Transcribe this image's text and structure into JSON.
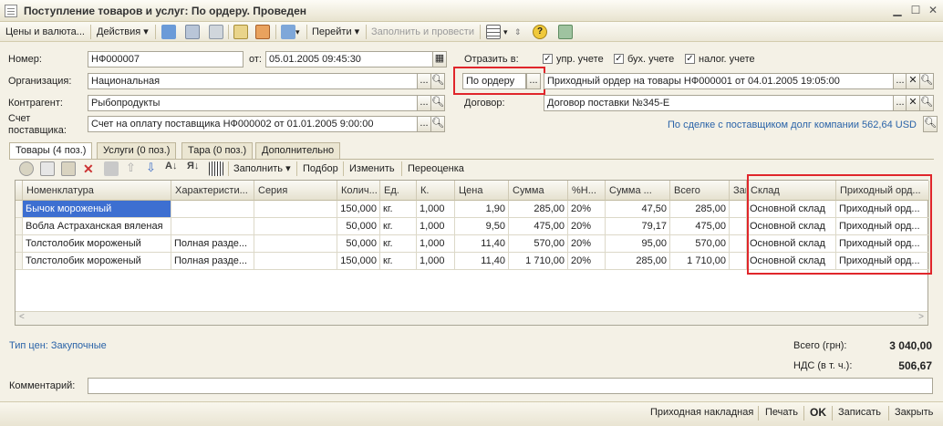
{
  "window": {
    "title": "Поступление товаров и услуг: По ордеру. Проведен"
  },
  "toolbar": {
    "prices": "Цены и валюта...",
    "actions": "Действия",
    "goto": "Перейти",
    "fill_post": "Заполнить и провести"
  },
  "form": {
    "number_label": "Номер:",
    "number": "НФ000007",
    "date_label": "от:",
    "date": "05.01.2005 09:45:30",
    "org_label": "Организация:",
    "org": "Национальная",
    "contractor_label": "Контрагент:",
    "contractor": "Рыбопродукты",
    "invoice_label": "Счет поставщика:",
    "invoice": "Счет на оплату поставщика НФ000002 от 01.01.2005 9:00:00",
    "reflect_label": "Отразить в:",
    "mgmt": "упр. учете",
    "acct": "бух. учете",
    "tax": "налог. учете",
    "order_mode": "По ордеру",
    "order_doc": "Приходный ордер на товары НФ000001 от 04.01.2005 19:05:00",
    "contract_label": "Договор:",
    "contract": "Договор поставки №345-Е",
    "debt": "По сделке с поставщиком долг компании 562,64 USD"
  },
  "tabs": [
    "Товары (4 поз.)",
    "Услуги (0 поз.)",
    "Тара (0 поз.)",
    "Дополнительно"
  ],
  "grid_toolbar": {
    "fill": "Заполнить",
    "select": "Подбор",
    "change": "Изменить",
    "reprice": "Переоценка"
  },
  "table": {
    "headers": [
      "Номенклатура",
      "Характеристи...",
      "Серия",
      "Колич...",
      "Ед.",
      "К.",
      "Цена",
      "Сумма",
      "%Н...",
      "Сумма ...",
      "Всего",
      "Заказ",
      "Склад",
      "Приходный орд..."
    ],
    "rows": [
      [
        "Бычок мороженый",
        "",
        "",
        "150,000",
        "кг.",
        "1,000",
        "1,90",
        "285,00",
        "20%",
        "47,50",
        "285,00",
        "",
        "Основной склад",
        "Приходный орд..."
      ],
      [
        "Вобла Астраханская вяленая",
        "",
        "",
        "50,000",
        "кг.",
        "1,000",
        "9,50",
        "475,00",
        "20%",
        "79,17",
        "475,00",
        "",
        "Основной склад",
        "Приходный орд..."
      ],
      [
        "Толстолобик мороженый",
        "Полная разде...",
        "",
        "50,000",
        "кг.",
        "1,000",
        "11,40",
        "570,00",
        "20%",
        "95,00",
        "570,00",
        "",
        "Основной склад",
        "Приходный орд..."
      ],
      [
        "Толстолобик мороженый",
        "Полная разде...",
        "",
        "150,000",
        "кг.",
        "1,000",
        "11,40",
        "1 710,00",
        "20%",
        "285,00",
        "1 710,00",
        "",
        "Основной склад",
        "Приходный орд..."
      ]
    ]
  },
  "footer": {
    "price_type": "Тип цен: Закупочные",
    "total_label": "Всего (грн):",
    "total": "3 040,00",
    "vat_label": "НДС (в т. ч.):",
    "vat": "506,67",
    "comment_label": "Комментарий:",
    "comment": ""
  },
  "buttons": {
    "invoice": "Приходная накладная",
    "print": "Печать",
    "ok": "OK",
    "save": "Записать",
    "close": "Закрыть"
  }
}
